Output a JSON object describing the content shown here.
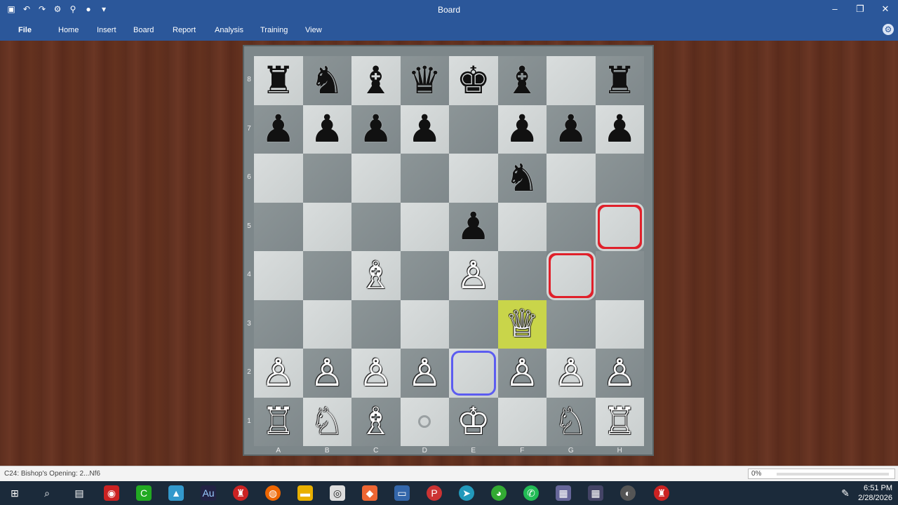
{
  "window": {
    "title": "Board"
  },
  "ribbon": {
    "tabs": [
      {
        "label": "File"
      },
      {
        "label": "Home"
      },
      {
        "label": "Insert"
      },
      {
        "label": "Board"
      },
      {
        "label": "Report"
      },
      {
        "label": "Analysis"
      },
      {
        "label": "Training"
      },
      {
        "label": "View"
      }
    ]
  },
  "board": {
    "ranks": [
      "8",
      "7",
      "6",
      "5",
      "4",
      "3",
      "2",
      "1"
    ],
    "files": [
      "A",
      "B",
      "C",
      "D",
      "E",
      "F",
      "G",
      "H"
    ],
    "rows": [
      [
        "♜",
        "♞",
        "♝",
        "♛",
        "♚",
        "♝",
        "",
        "♜"
      ],
      [
        "♟",
        "♟",
        "♟",
        "♟",
        "",
        "♟",
        "♟",
        "♟"
      ],
      [
        "",
        "",
        "",
        "",
        "",
        "♞",
        "",
        ""
      ],
      [
        "",
        "",
        "",
        "",
        "♟",
        "",
        "",
        ""
      ],
      [
        "",
        "",
        "♗",
        "",
        "♙",
        "",
        "",
        ""
      ],
      [
        "",
        "",
        "",
        "",
        "",
        "♕",
        "",
        ""
      ],
      [
        "♙",
        "♙",
        "♙",
        "♙",
        "",
        "♙",
        "♙",
        "♙"
      ],
      [
        "♖",
        "♘",
        "♗",
        "",
        "♔",
        "",
        "♘",
        "♖"
      ]
    ],
    "highlights": {
      "red": [
        "h5",
        "g4"
      ],
      "blue": [
        "e2"
      ],
      "yellow": [
        "f3"
      ],
      "dot": [
        "d1"
      ]
    }
  },
  "status": {
    "opening": "C24: Bishop's Opening: 2...Nf6",
    "progress": "0%"
  },
  "taskbar": {
    "time": "6:51 PM",
    "date": "2/28/2026"
  }
}
